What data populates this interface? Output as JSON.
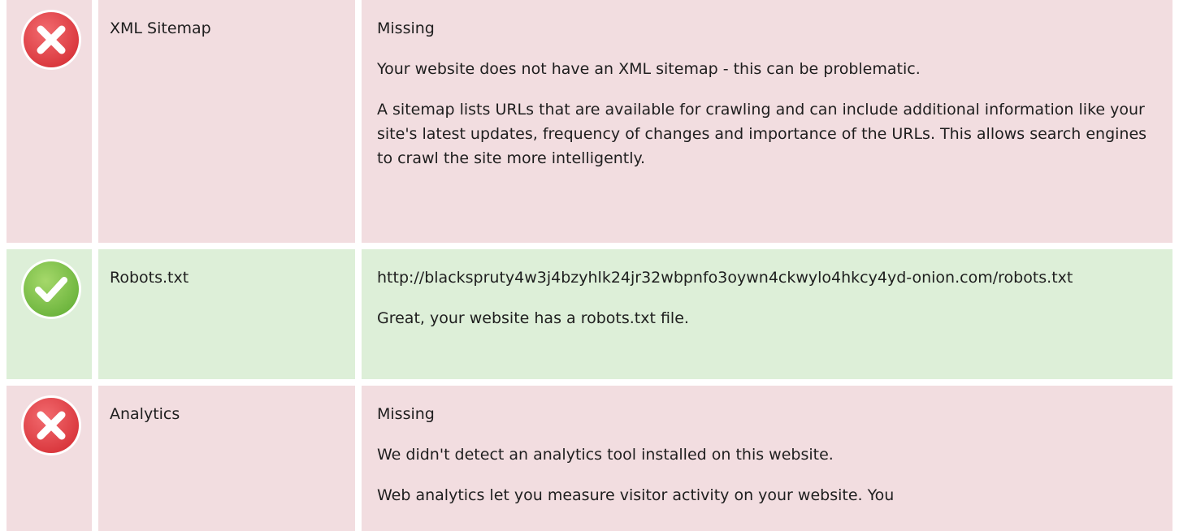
{
  "rows": [
    {
      "status": "fail",
      "icon": "error-x-icon",
      "name": "XML Sitemap",
      "result": "Missing",
      "paragraphs": [
        "Your website does not have an XML sitemap - this can be problematic.",
        "A sitemap lists URLs that are available for crawling and can include additional information like your site's latest updates, frequency of changes and importance of the URLs. This allows search engines to crawl the site more intelligently."
      ]
    },
    {
      "status": "pass",
      "icon": "success-check-icon",
      "name": "Robots.txt",
      "result": "http://blackspruty4w3j4bzyhlk24jr32wbpnfo3oywn4ckwylo4hkcy4yd-onion.com/robots.txt",
      "paragraphs": [
        "Great, your website has a robots.txt file."
      ]
    },
    {
      "status": "fail",
      "icon": "error-x-icon",
      "name": "Analytics",
      "result": "Missing",
      "paragraphs": [
        "We didn't detect an analytics tool installed on this website.",
        "Web analytics let you measure visitor activity on your website. You"
      ]
    }
  ],
  "colors": {
    "fail_background": "#f2dde0",
    "pass_background": "#ddefd8",
    "error_icon": "#e0444a",
    "success_icon": "#7cc04b"
  }
}
